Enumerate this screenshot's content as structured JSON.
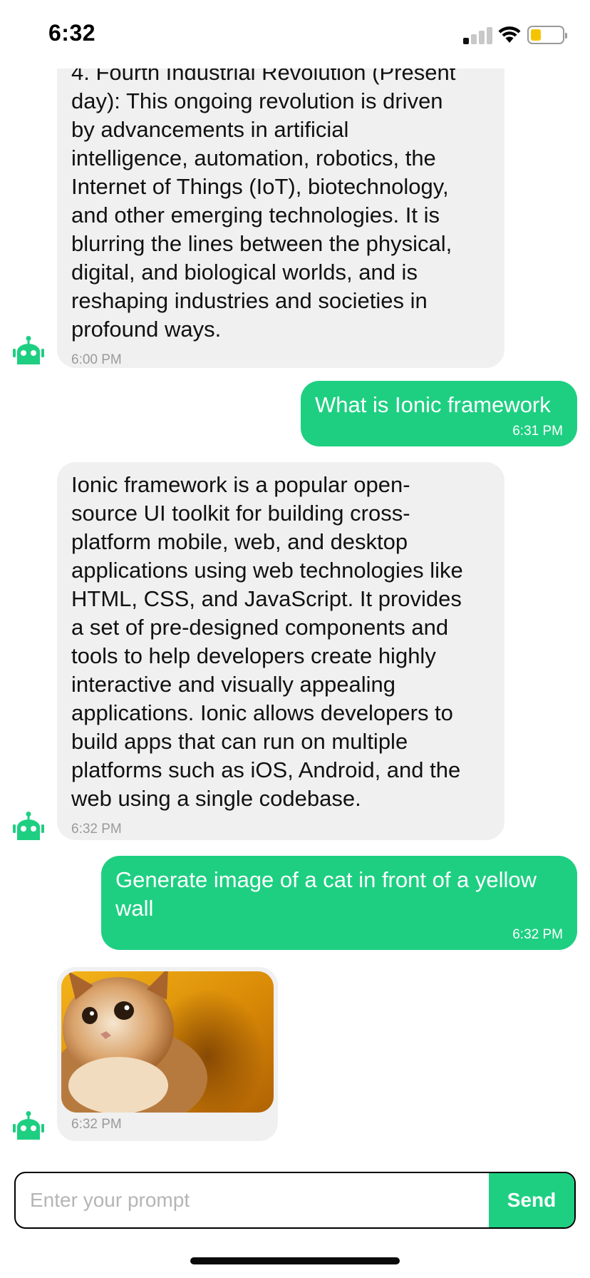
{
  "status_bar": {
    "time": "6:32",
    "battery_level": 0.25,
    "signal_bars_active": 1
  },
  "messages": [
    {
      "sender": "bot",
      "lines": [
        "4. Fourth Industrial Revolution (Present",
        "day): This ongoing revolution is driven",
        "by advancements in artificial",
        "intelligence, automation, robotics, the",
        "Internet of Things (IoT), biotechnology,",
        "and other emerging technologies. It is",
        "blurring the lines between the physical,",
        "digital, and biological worlds, and is",
        "reshaping industries and societies in",
        "profound ways."
      ],
      "time": "6:00 PM"
    },
    {
      "sender": "user",
      "lines": [
        "What is Ionic framework"
      ],
      "time": "6:31 PM"
    },
    {
      "sender": "bot",
      "lines": [
        "Ionic framework is a popular open-",
        "source UI toolkit for building cross-",
        "platform mobile, web, and desktop",
        "applications using web technologies like",
        "HTML, CSS, and JavaScript. It provides",
        "a set of pre-designed components and",
        "tools to help developers create highly",
        "interactive and visually appealing",
        "applications. Ionic allows developers to",
        "build apps that can run on multiple",
        "platforms such as iOS, Android, and the",
        "web using a single codebase."
      ],
      "time": "6:32 PM"
    },
    {
      "sender": "user",
      "lines": [
        "Generate image of a cat in front of a yellow",
        "wall"
      ],
      "time": "6:32 PM"
    },
    {
      "sender": "bot",
      "image": "cat-in-front-of-yellow-wall",
      "time": "6:32 PM"
    }
  ],
  "input": {
    "placeholder": "Enter your prompt",
    "value": "",
    "send_label": "Send"
  },
  "colors": {
    "accent": "#1ecf82",
    "bot_bubble": "#f0f0f0",
    "timestamp": "#9a9a9a",
    "battery": "#f5c400"
  },
  "icons": {
    "avatar": "robot-icon",
    "wifi": "wifi-icon",
    "signal": "cellular-signal-icon",
    "battery": "battery-icon"
  }
}
